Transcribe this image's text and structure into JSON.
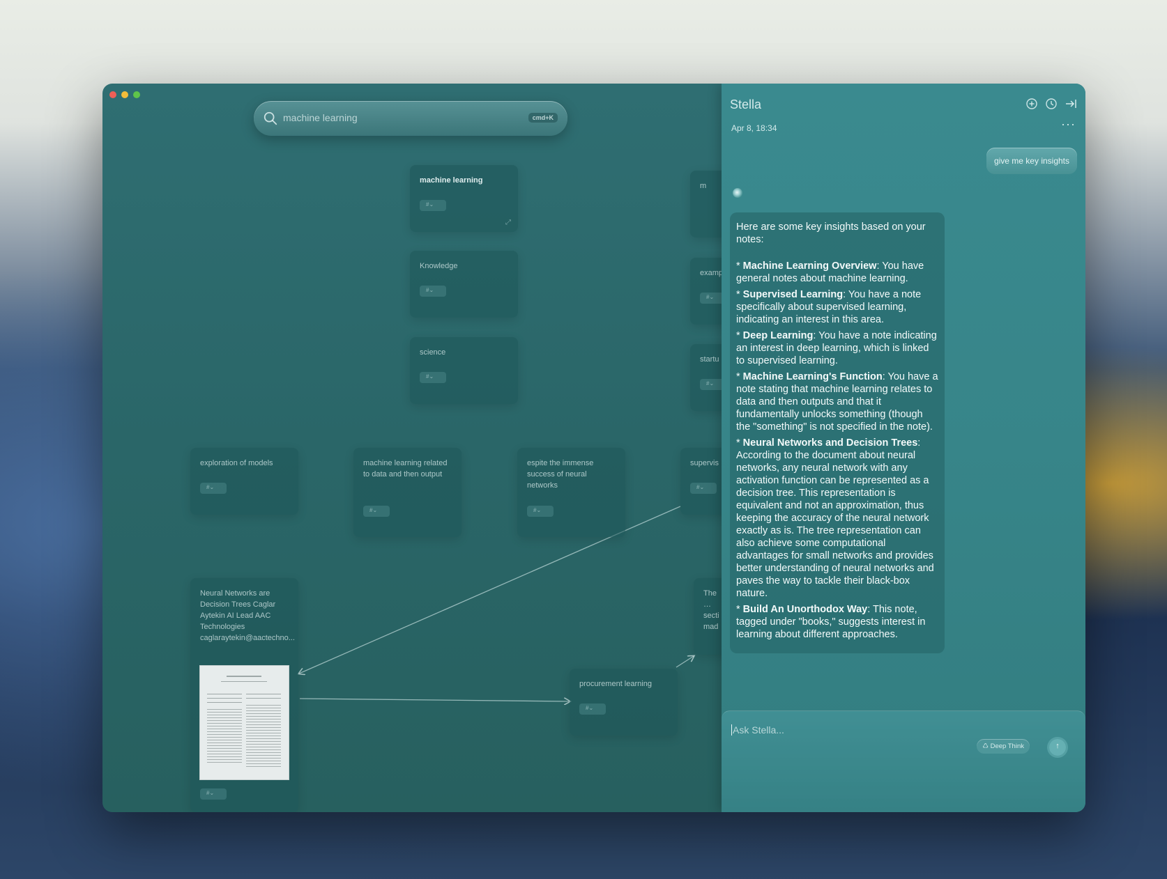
{
  "search": {
    "value": "machine learning",
    "shortcut": "cmd+K"
  },
  "cards": {
    "c1": "machine learning",
    "c2": "Knowledge",
    "c3": "science",
    "c4": "exploration of models",
    "c5": "machine learning related to data and then output",
    "c6": "espite the immense success of neural networks",
    "c7": "Neural Networks are Decision Trees Caglar Aytekin AI Lead AAC Technologies caglaraytekin@aactechno...",
    "c8": "procurement learning",
    "p1": "m",
    "p2": "examp",
    "p3": "startu",
    "p4": "supervis",
    "p5": "The … secti mad"
  },
  "panel": {
    "title": "Stella",
    "date": "Apr 8, 18:34",
    "more": "···",
    "user_message": "give me key insights",
    "intro": "Here are some key insights based on your notes:",
    "insights": [
      {
        "head": "Machine Learning Overview",
        "body": ": You have general notes about machine learning."
      },
      {
        "head": "Supervised Learning",
        "body": ": You have a note specifically about supervised learning, indicating an interest in this area."
      },
      {
        "head": "Deep Learning",
        "body": ": You have a note indicating an interest in deep learning, which is linked to supervised learning."
      },
      {
        "head": "Machine Learning's Function",
        "body": ": You have a note stating that machine learning relates to data and then outputs and that it fundamentally unlocks something (though the \"something\" is not specified in the note)."
      },
      {
        "head": "Neural Networks and Decision Trees",
        "body": ": According to the document about neural networks, any neural network with any activation function can be represented as a decision tree. This representation is equivalent and not an approximation, thus keeping the accuracy of the neural network exactly as is. The tree representation can also achieve some computational advantages for small networks and provides better understanding of neural networks and paves the way to tackle their black-box nature."
      },
      {
        "head": "Build An Unorthodox Way",
        "body": ": This note, tagged under \"books,\" suggests interest in learning about different approaches."
      }
    ],
    "bullet": "* ",
    "placeholder": "Ask Stella...",
    "deep_think": "Deep Think",
    "send": "↑"
  },
  "colors": {
    "accent": "#3a8a8f",
    "window_bg": "#2a6668"
  }
}
